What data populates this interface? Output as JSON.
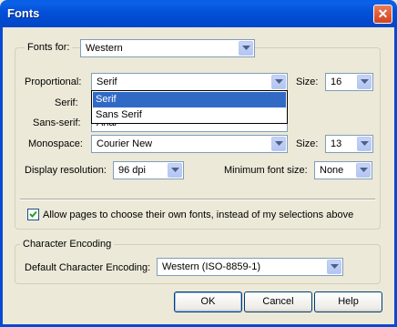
{
  "window": {
    "title": "Fonts",
    "close_glyph": "✕"
  },
  "fonts_group": {
    "fonts_for_label": "Fonts for:",
    "fonts_for_value": "Western",
    "proportional_label": "Proportional:",
    "proportional_value": "Serif",
    "proportional_size_label": "Size:",
    "proportional_size_value": "16",
    "serif_label": "Serif:",
    "sans_serif_label": "Sans-serif:",
    "sans_serif_value_partial": "Arial",
    "monospace_label": "Monospace:",
    "monospace_value": "Courier New",
    "monospace_size_label": "Size:",
    "monospace_size_value": "13",
    "display_resolution_label": "Display resolution:",
    "display_resolution_value": "96 dpi",
    "min_font_size_label": "Minimum font size:",
    "min_font_size_value": "None",
    "proportional_options": [
      {
        "label": "Serif",
        "selected": true
      },
      {
        "label": "Sans Serif",
        "selected": false
      }
    ],
    "allow_pages_label": "Allow pages to choose their own fonts, instead of my selections above",
    "allow_pages_checked": true
  },
  "encoding_group": {
    "title": "Character Encoding",
    "default_label": "Default Character Encoding:",
    "default_value": "Western (ISO-8859-1)"
  },
  "buttons": {
    "ok": "OK",
    "cancel": "Cancel",
    "help": "Help"
  },
  "colors": {
    "accent": "#316AC5",
    "titlebar": "#0350D8",
    "face": "#ECE9D8"
  }
}
